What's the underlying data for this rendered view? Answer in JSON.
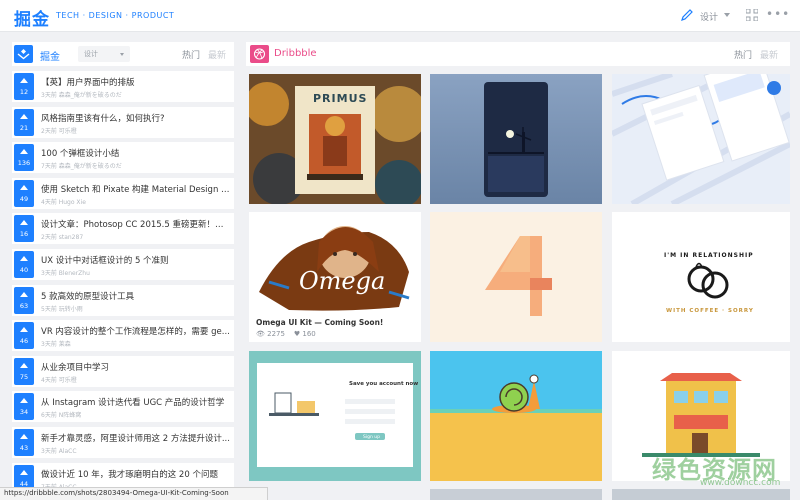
{
  "header": {
    "logo": "掘金",
    "tagline": "TECH · DESIGN · PRODUCT",
    "category_label": "设计"
  },
  "left_panel": {
    "title": "掘金",
    "filter_value": "设计",
    "tab_hot": "热门",
    "tab_new": "最新",
    "articles": [
      {
        "title": "【英】用户界面中的排版",
        "meta": "3天前  森森_俺が新を破るのだ",
        "votes": "12"
      },
      {
        "title": "风格指南里该有什么，如何执行?",
        "meta": "2天前  可乐橙",
        "votes": "21"
      },
      {
        "title": "100 个弹框设计小结",
        "meta": "7天前  森森_俺が新を破るのだ",
        "votes": "136"
      },
      {
        "title": "使用 Sketch 和 Pixate 构建 Material Design 原型...",
        "meta": "4天前  Hugo Xie",
        "votes": "49"
      },
      {
        "title": "设计文章：Photosop CC 2015.5 重磅更新！超实...",
        "meta": "2天前  stan287",
        "votes": "16"
      },
      {
        "title": "UX 设计中对话框设计的 5 个准则",
        "meta": "3天前  BlenerZhu",
        "votes": "40"
      },
      {
        "title": "5 款高效的原型设计工具",
        "meta": "5天前  玩转小雨",
        "votes": "63"
      },
      {
        "title": "VR 内容设计的整个工作流程是怎样的，需要 ge...",
        "meta": "3天前  莱森",
        "votes": "46"
      },
      {
        "title": "从业余项目中学习",
        "meta": "4天前  可乐橙",
        "votes": "75"
      },
      {
        "title": "从 Instagram 设计迭代看 UGC 产品的设计哲学",
        "meta": "6天前  N阵蜂窝",
        "votes": "34"
      },
      {
        "title": "新手才靠灵感，阿里设计师用这 2 方法提升设计...",
        "meta": "3天前  AlaCC",
        "votes": "43"
      },
      {
        "title": "做设计近 10 年，我才琢磨明白的这 20 个问题",
        "meta": "7天前  AlaCC",
        "votes": "44"
      }
    ]
  },
  "right_panel": {
    "title": "Dribbble",
    "tab_hot": "热门",
    "tab_new": "最新",
    "featured_caption": "Omega UI Kit — Coming Soon!",
    "featured_views": "2275",
    "featured_likes": "160",
    "shot2_headline": "Save you account now",
    "shot2_cta": "Sign up",
    "shot3_art_text": "Omega",
    "shot4_badge_text": "I'M IN RELATIONSHIP",
    "shot4_badge_text2": "WITH COFFEE · SORRY",
    "shot1_poster_text": "PRIMUS"
  },
  "status_bar": {
    "url": "https://dribbble.com/shots/2803494-Omega-UI-Kit-Coming-Soon"
  },
  "watermark": {
    "text": "绿色资源网",
    "url": "www.downcc.com"
  },
  "colors": {
    "brand_blue": "#1e80ff",
    "dribbble_pink": "#ea4c89"
  }
}
